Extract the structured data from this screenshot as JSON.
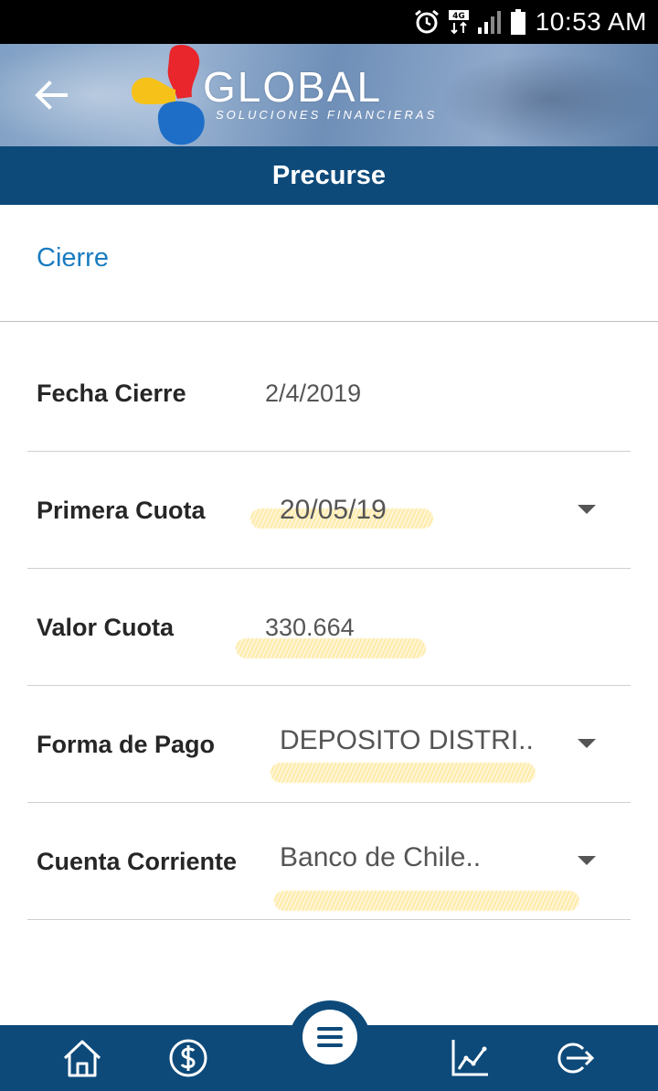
{
  "status_bar": {
    "time": "10:53 AM",
    "network": "4G",
    "icons": [
      "alarm-icon",
      "network-4g-icon",
      "signal-icon",
      "battery-icon"
    ]
  },
  "header": {
    "brand": "GLOBAL",
    "brand_subtitle": "SOLUCIONES FINANCIERAS",
    "back_icon": "arrow-back-icon"
  },
  "title_bar": {
    "title": "Precurse"
  },
  "section": {
    "title": "Cierre"
  },
  "form": {
    "rows": [
      {
        "label": "Fecha Cierre",
        "value": "2/4/2019"
      },
      {
        "label": "Primera Cuota",
        "value": "20/05/19"
      },
      {
        "label": "Valor Cuota",
        "value": "330.664"
      },
      {
        "label": "Forma de Pago",
        "value": "DEPOSITO DISTRI.."
      },
      {
        "label": "Cuenta Corriente",
        "value": "Banco de Chile.."
      }
    ]
  },
  "bottom_nav": {
    "items": [
      "home-icon",
      "dollar-icon",
      "menu-icon",
      "chart-icon",
      "logout-icon"
    ]
  },
  "colors": {
    "primary": "#0d4a7a",
    "accent_link": "#1a7cc1",
    "logo_red": "#e8262b",
    "logo_yellow": "#f6c21a",
    "logo_blue": "#1e6ec8",
    "highlight": "#ffd650"
  }
}
